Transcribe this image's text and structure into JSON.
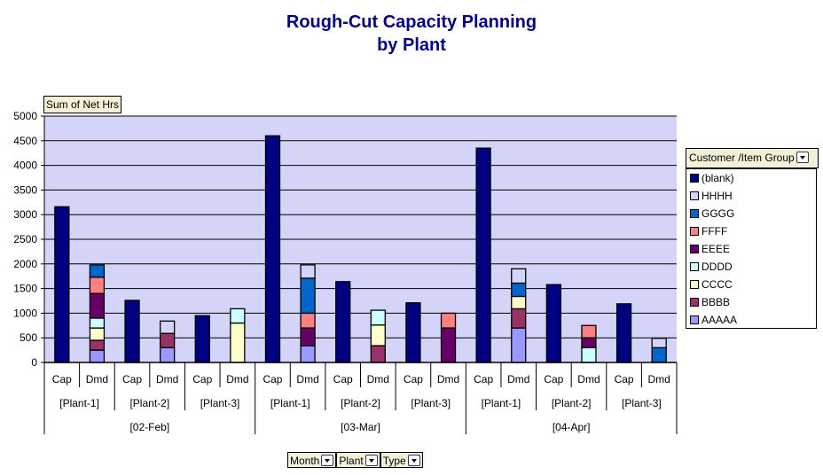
{
  "chart_data": {
    "type": "bar",
    "stacked": true,
    "title": "Rough-Cut Capacity Planning\nby Plant",
    "title_lines": [
      "Rough-Cut Capacity Planning",
      "by Plant"
    ],
    "data_field_label": "Sum of Net Hrs",
    "ylim": [
      0,
      5000
    ],
    "yticks": [
      0,
      500,
      1000,
      1500,
      2000,
      2500,
      3000,
      3500,
      4000,
      4500,
      5000
    ],
    "grid": true,
    "legend_placement": "right",
    "legend_title": "Customer /Item Group",
    "months": [
      "[02-Feb]",
      "[03-Mar]",
      "[04-Apr]"
    ],
    "plants": [
      "[Plant-1]",
      "[Plant-2]",
      "[Plant-3]"
    ],
    "types": [
      "Cap",
      "Dmd"
    ],
    "series": [
      {
        "name": "AAAAA",
        "color": "#9999FF",
        "values": [
          0,
          250,
          0,
          300,
          0,
          0,
          0,
          340,
          0,
          0,
          0,
          0,
          0,
          700,
          0,
          0,
          0,
          0
        ]
      },
      {
        "name": "BBBB",
        "color": "#993366",
        "values": [
          0,
          200,
          0,
          290,
          0,
          0,
          0,
          0,
          0,
          340,
          0,
          0,
          0,
          390,
          0,
          0,
          0,
          0
        ]
      },
      {
        "name": "CCCC",
        "color": "#FFFFCC",
        "values": [
          0,
          250,
          0,
          0,
          0,
          800,
          0,
          0,
          0,
          420,
          0,
          0,
          0,
          250,
          0,
          0,
          0,
          0
        ]
      },
      {
        "name": "DDDD",
        "color": "#CCFFFF",
        "values": [
          0,
          200,
          0,
          0,
          0,
          290,
          0,
          0,
          0,
          300,
          0,
          0,
          0,
          0,
          0,
          300,
          0,
          0
        ]
      },
      {
        "name": "EEEE",
        "color": "#660066",
        "values": [
          0,
          500,
          0,
          0,
          0,
          0,
          0,
          360,
          0,
          0,
          0,
          700,
          0,
          0,
          0,
          200,
          0,
          0
        ]
      },
      {
        "name": "FFFF",
        "color": "#FF8080",
        "values": [
          0,
          330,
          0,
          0,
          0,
          0,
          0,
          300,
          0,
          0,
          0,
          300,
          0,
          0,
          0,
          250,
          0,
          0
        ]
      },
      {
        "name": "GGGG",
        "color": "#0066CC",
        "values": [
          0,
          250,
          0,
          0,
          0,
          0,
          0,
          710,
          0,
          0,
          0,
          0,
          0,
          270,
          0,
          0,
          0,
          300
        ]
      },
      {
        "name": "HHHH",
        "color": "#D4D4F8",
        "values": [
          0,
          0,
          0,
          250,
          0,
          0,
          0,
          270,
          0,
          0,
          0,
          0,
          0,
          290,
          0,
          0,
          0,
          190
        ]
      },
      {
        "name": "(blank)",
        "color": "#000080",
        "values": [
          3160,
          0,
          1260,
          0,
          950,
          0,
          4600,
          0,
          1640,
          0,
          1210,
          0,
          4350,
          0,
          1580,
          0,
          1190,
          0
        ]
      }
    ],
    "legend_order": [
      "(blank)",
      "HHHH",
      "GGGG",
      "FFFF",
      "EEEE",
      "DDDD",
      "CCCC",
      "BBBB",
      "AAAAA"
    ]
  },
  "page_fields": {
    "month_label": "Month",
    "plant_label": "Plant",
    "type_label": "Type"
  },
  "colors": {
    "plot_background": "#D4D4F8",
    "title": "#000080",
    "field_button": "#F4F0D8"
  }
}
